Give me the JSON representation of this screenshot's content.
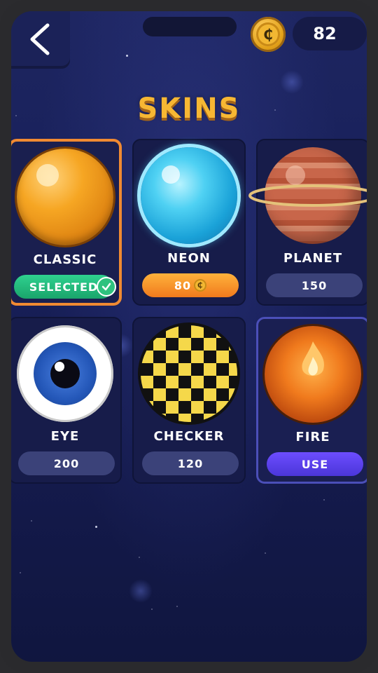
{
  "header": {
    "coins": "82",
    "coin_symbol": "₵",
    "back_icon": "chevron-left-icon"
  },
  "title": "SKINS",
  "skins": [
    {
      "name": "CLASSIC",
      "action": "SELECTED",
      "state": "selected"
    },
    {
      "name": "NEON",
      "action": "80",
      "state": "price-featured"
    },
    {
      "name": "PLANET",
      "action": "150",
      "state": "locked"
    },
    {
      "name": "EYE",
      "action": "200",
      "state": "locked"
    },
    {
      "name": "CHECKER",
      "action": "120",
      "state": "locked"
    },
    {
      "name": "FIRE",
      "action": "USE",
      "state": "owned"
    }
  ],
  "colors": {
    "title": "#f7b733",
    "selected_border": "#f08a32",
    "selected_pill": "#2fd18f",
    "price_pill_featured": "#ffb23b",
    "use_pill": "#6d4dff",
    "background": "#18205a"
  }
}
